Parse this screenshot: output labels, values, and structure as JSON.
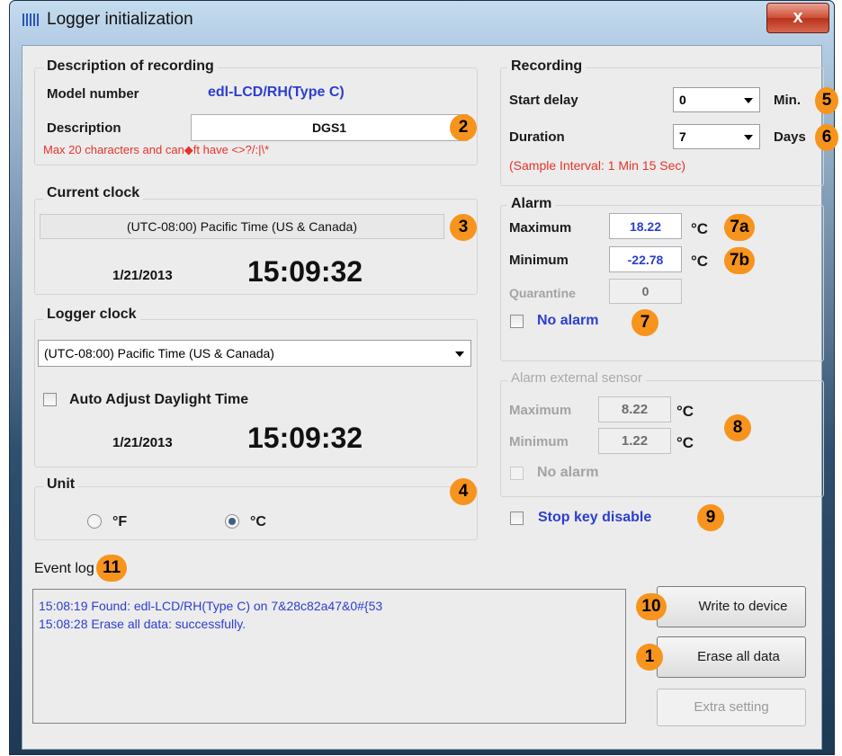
{
  "window": {
    "title": "Logger initialization",
    "close_label": "x"
  },
  "description_group": {
    "legend": "Description of recording",
    "model_label": "Model number",
    "model_value": "edl-LCD/RH(Type C)",
    "description_label": "Description",
    "description_value": "DGS1",
    "hint": "Max 20 characters and can◆ft have <>?/:|\\*"
  },
  "current_clock": {
    "legend": "Current clock",
    "timezone": "(UTC-08:00) Pacific Time (US & Canada)",
    "date": "1/21/2013",
    "time": "15:09:32"
  },
  "logger_clock": {
    "legend": "Logger clock",
    "timezone": "(UTC-08:00) Pacific Time (US & Canada)",
    "auto_adjust_label": "Auto Adjust Daylight Time",
    "auto_adjust_checked": false,
    "date": "1/21/2013",
    "time": "15:09:32"
  },
  "unit": {
    "legend": "Unit",
    "options": [
      {
        "label": "°F",
        "selected": false
      },
      {
        "label": "°C",
        "selected": true
      }
    ]
  },
  "recording": {
    "legend": "Recording",
    "start_delay_label": "Start delay",
    "start_delay_value": "0",
    "start_delay_unit": "Min.",
    "duration_label": "Duration",
    "duration_value": "7",
    "duration_unit": "Days",
    "sample_interval": "(Sample Interval: 1 Min 15 Sec)"
  },
  "alarm": {
    "legend": "Alarm",
    "maximum_label": "Maximum",
    "maximum_value": "18.22",
    "minimum_label": "Minimum",
    "minimum_value": "-22.78",
    "unit": "°C",
    "quarantine_label": "Quarantine",
    "quarantine_value": "0",
    "no_alarm_label": "No alarm",
    "no_alarm_checked": false
  },
  "alarm_external": {
    "legend": "Alarm external sensor",
    "maximum_label": "Maximum",
    "maximum_value": "8.22",
    "minimum_label": "Minimum",
    "minimum_value": "1.22",
    "unit": "°C",
    "no_alarm_label": "No alarm"
  },
  "stop_key": {
    "label": "Stop key disable",
    "checked": false
  },
  "event_log": {
    "label": "Event log",
    "lines": [
      "15:08:19 Found: edl-LCD/RH(Type C) on 7&28c82a47&0#{53",
      "15:08:28 Erase all data: successfully."
    ]
  },
  "buttons": {
    "write": "Write to device",
    "erase": "Erase all data",
    "extra": "Extra setting"
  },
  "badges": {
    "b1": "1",
    "b2": "2",
    "b3": "3",
    "b4": "4",
    "b5": "5",
    "b6": "6",
    "b7a": "7a",
    "b7b": "7b",
    "b7": "7",
    "b8": "8",
    "b9": "9",
    "b10": "10",
    "b11": "11"
  },
  "colors": {
    "accent_blue": "#2c3ed0",
    "warning_red": "#e6332a",
    "badge_orange": "#f7941d"
  }
}
